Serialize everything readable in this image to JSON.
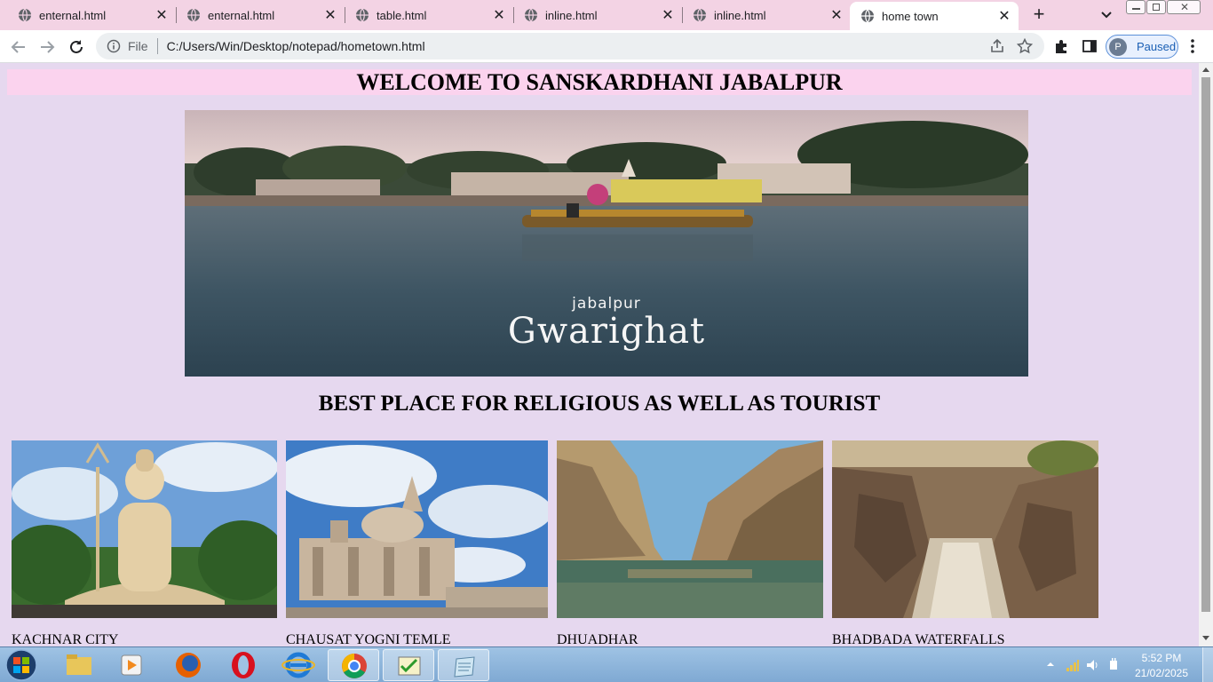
{
  "browser": {
    "tabs": [
      {
        "title": "enternal.html",
        "active": false
      },
      {
        "title": "enternal.html",
        "active": false
      },
      {
        "title": "table.html",
        "active": false
      },
      {
        "title": "inline.html",
        "active": false
      },
      {
        "title": "inline.html",
        "active": false
      },
      {
        "title": "home town",
        "active": true
      }
    ],
    "new_tab_label": "+",
    "omnibox": {
      "scheme_label": "File",
      "url": "C:/Users/Win/Desktop/notepad/hometown.html"
    },
    "profile": {
      "initial": "P",
      "status": "Paused"
    }
  },
  "page": {
    "heading": "WELCOME TO SANSKARDHANI JABALPUR",
    "hero": {
      "small_text": "jabalpur",
      "big_text": "Gwarighat"
    },
    "subheading": "BEST PLACE FOR RELIGIOUS AS WELL AS TOURIST",
    "gallery": [
      {
        "caption": "KACHNAR CITY"
      },
      {
        "caption": "CHAUSAT YOGNI TEMLE"
      },
      {
        "caption": "DHUADHAR"
      },
      {
        "caption": "BHADBADA WATERFALLS"
      }
    ]
  },
  "taskbar": {
    "time": "5:52 PM",
    "date": "21/02/2025"
  },
  "colors": {
    "page_background": "#e6d8ef",
    "heading_background": "#fbd3ee",
    "tab_strip": "#f3d3e4",
    "profile_accent": "#1a5fb4"
  }
}
